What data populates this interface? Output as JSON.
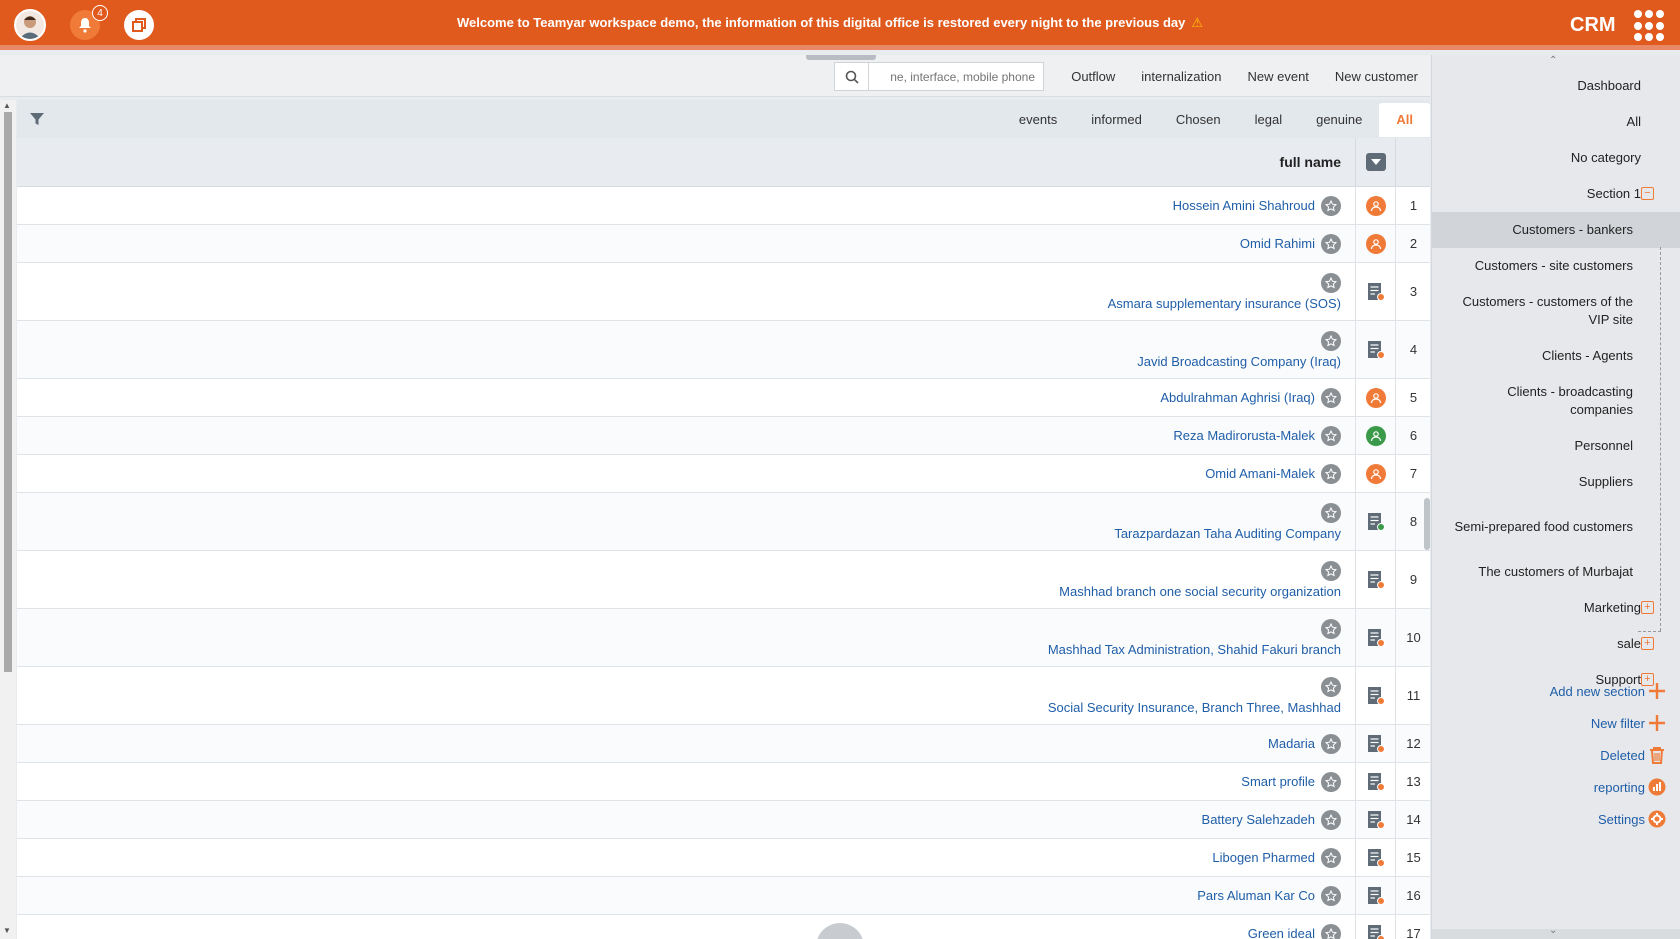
{
  "topbar": {
    "notification_count": "4",
    "message": "Welcome to Teamyar  workspace demo, the information of this digital office is restored every night to the previous day",
    "brand": "CRM",
    "colors": {
      "bar": "#e05a1e",
      "accent": "#f07a37"
    }
  },
  "toolbar": {
    "search_placeholder": "ne, interface, mobile phone",
    "links": [
      "Outflow",
      "internalization",
      "New event",
      "New customer"
    ]
  },
  "tabs": {
    "items": [
      "events",
      "informed",
      "Chosen",
      "legal",
      "genuine",
      "All"
    ],
    "active": "All"
  },
  "table": {
    "header_name": "full name",
    "rows": [
      {
        "num": "1",
        "name": "Hossein Amini Shahroud",
        "type": "person-orange"
      },
      {
        "num": "2",
        "name": "Omid Rahimi",
        "type": "person-orange"
      },
      {
        "num": "3",
        "name": "Asmara supplementary insurance (SOS)",
        "type": "company"
      },
      {
        "num": "4",
        "name": "Javid Broadcasting Company (Iraq)",
        "type": "company"
      },
      {
        "num": "5",
        "name": "Abdulrahman Aghrisi (Iraq)",
        "type": "person-orange"
      },
      {
        "num": "6",
        "name": "Reza Madirorusta-Malek",
        "type": "person-green"
      },
      {
        "num": "7",
        "name": "Omid Amani-Malek",
        "type": "person-orange"
      },
      {
        "num": "8",
        "name": "Tarazpardazan Taha Auditing Company",
        "type": "company-green"
      },
      {
        "num": "9",
        "name": "Mashhad branch one social security organization",
        "type": "company"
      },
      {
        "num": "10",
        "name": "Mashhad Tax Administration, Shahid Fakuri branch",
        "type": "company"
      },
      {
        "num": "11",
        "name": "Social Security Insurance, Branch Three, Mashhad",
        "type": "company"
      },
      {
        "num": "12",
        "name": "Madaria",
        "type": "company"
      },
      {
        "num": "13",
        "name": "Smart profile",
        "type": "company"
      },
      {
        "num": "14",
        "name": "Battery Salehzadeh",
        "type": "company"
      },
      {
        "num": "15",
        "name": "Libogen Pharmed",
        "type": "company"
      },
      {
        "num": "16",
        "name": "Pars Aluman Kar Co",
        "type": "company"
      },
      {
        "num": "17",
        "name": "Green ideal",
        "type": "company"
      }
    ]
  },
  "sidebar": {
    "items": [
      {
        "label": "Dashboard"
      },
      {
        "label": "All"
      },
      {
        "label": "No category"
      },
      {
        "label": "Section 1",
        "expander": "−"
      },
      {
        "label": "Customers - bankers",
        "active": true
      },
      {
        "label": "Customers - site customers"
      },
      {
        "label": "Customers - customers of the VIP site"
      },
      {
        "label": "Clients - Agents"
      },
      {
        "label": "Clients - broadcasting companies"
      },
      {
        "label": "Personnel"
      },
      {
        "label": "Suppliers"
      },
      {
        "label": "Semi-prepared food customers"
      },
      {
        "label": "The customers of Murbajat"
      },
      {
        "label": "Marketing",
        "expander": "+"
      },
      {
        "label": "sale",
        "expander": "+"
      },
      {
        "label": "Support",
        "expander": "+"
      }
    ],
    "actions": [
      {
        "label": "Add new section",
        "icon": "plus-icon"
      },
      {
        "label": "New filter",
        "icon": "plus-icon"
      },
      {
        "label": "Deleted",
        "icon": "trash-icon"
      },
      {
        "label": "reporting",
        "icon": "chart-icon"
      },
      {
        "label": "Settings",
        "icon": "gear-icon"
      }
    ]
  }
}
